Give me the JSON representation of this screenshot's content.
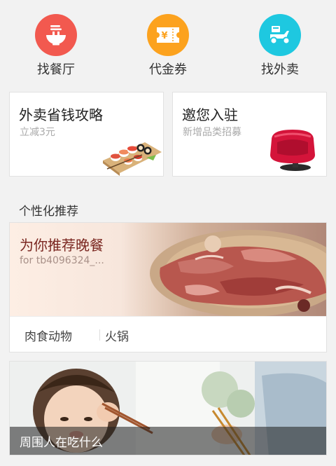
{
  "categories": [
    {
      "label": "找餐厅",
      "icon": "noodle-bowl-icon",
      "color": "#f2594f"
    },
    {
      "label": "代金券",
      "icon": "voucher-icon",
      "color": "#fca21e",
      "glyph": "¥"
    },
    {
      "label": "找外卖",
      "icon": "delivery-scooter-icon",
      "color": "#1ec8e0"
    }
  ],
  "promos": [
    {
      "title": "外卖省钱攻略",
      "subtitle": "立减3元",
      "image": "sushi-platter-icon"
    },
    {
      "title": "邀您入驻",
      "subtitle": "新增品类招募",
      "image": "red-armchair-icon"
    }
  ],
  "section": {
    "title": "个性化推荐"
  },
  "recommend": {
    "title": "为你推荐晚餐",
    "subtitle": "for tb4096324_...",
    "tags": [
      "肉食动物",
      "火锅"
    ],
    "image": "pizza-photo"
  },
  "people": {
    "label": "周围人在吃什么",
    "image": "child-eating-photo"
  }
}
